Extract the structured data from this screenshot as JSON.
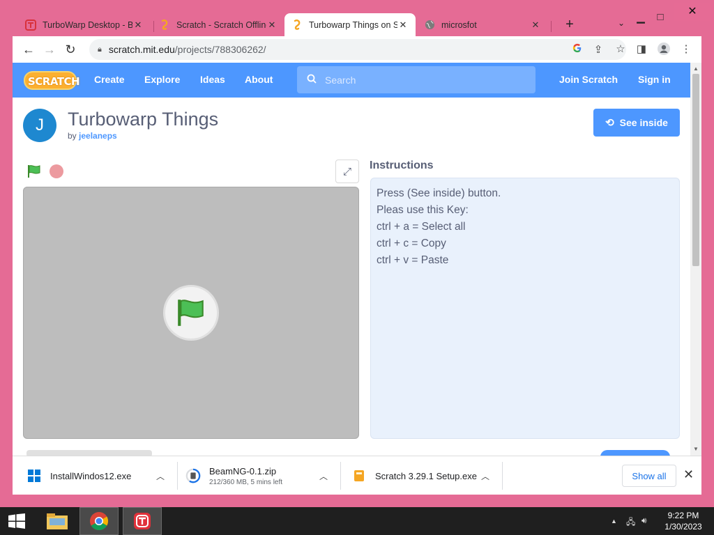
{
  "browser": {
    "tabs": [
      {
        "title": "TurboWarp Desktop - B",
        "active": false
      },
      {
        "title": "Scratch - Scratch Offline",
        "active": false
      },
      {
        "title": "Turbowarp Things on Sc",
        "active": true
      },
      {
        "title": "microsfot",
        "active": false
      }
    ],
    "new_tab": "+",
    "url_host": "scratch.mit.edu",
    "url_path": "/projects/788306262/"
  },
  "scratch_nav": {
    "logo": "SCRATCH",
    "links": [
      "Create",
      "Explore",
      "Ideas",
      "About"
    ],
    "search_placeholder": "Search",
    "join": "Join Scratch",
    "sign_in": "Sign in"
  },
  "project": {
    "avatar_letter": "J",
    "title": "Turbowarp Things",
    "by_label": "by",
    "author": "jeelaneps",
    "see_inside": "See inside",
    "instructions_heading": "Instructions",
    "instructions": [
      "Press (See inside) button.",
      "Pleas use this Key:",
      "ctrl + a = Select all",
      "ctrl + c = Copy",
      "ctrl + v = Paste"
    ]
  },
  "downloads": {
    "items": [
      {
        "name": "InstallWindos12.exe",
        "sub": ""
      },
      {
        "name": "BeamNG-0.1.zip",
        "sub": "212/360 MB, 5 mins left",
        "progress": 0.59
      },
      {
        "name": "Scratch 3.29.1 Setup.exe",
        "sub": ""
      }
    ],
    "show_all": "Show all"
  },
  "taskbar": {
    "time": "9:22 PM",
    "date": "1/30/2023"
  },
  "colors": {
    "frame": "#e56b95",
    "scratch_blue": "#4d97ff",
    "stage_bg": "#bdbdbd",
    "instructions_bg": "#e9f1fc"
  }
}
